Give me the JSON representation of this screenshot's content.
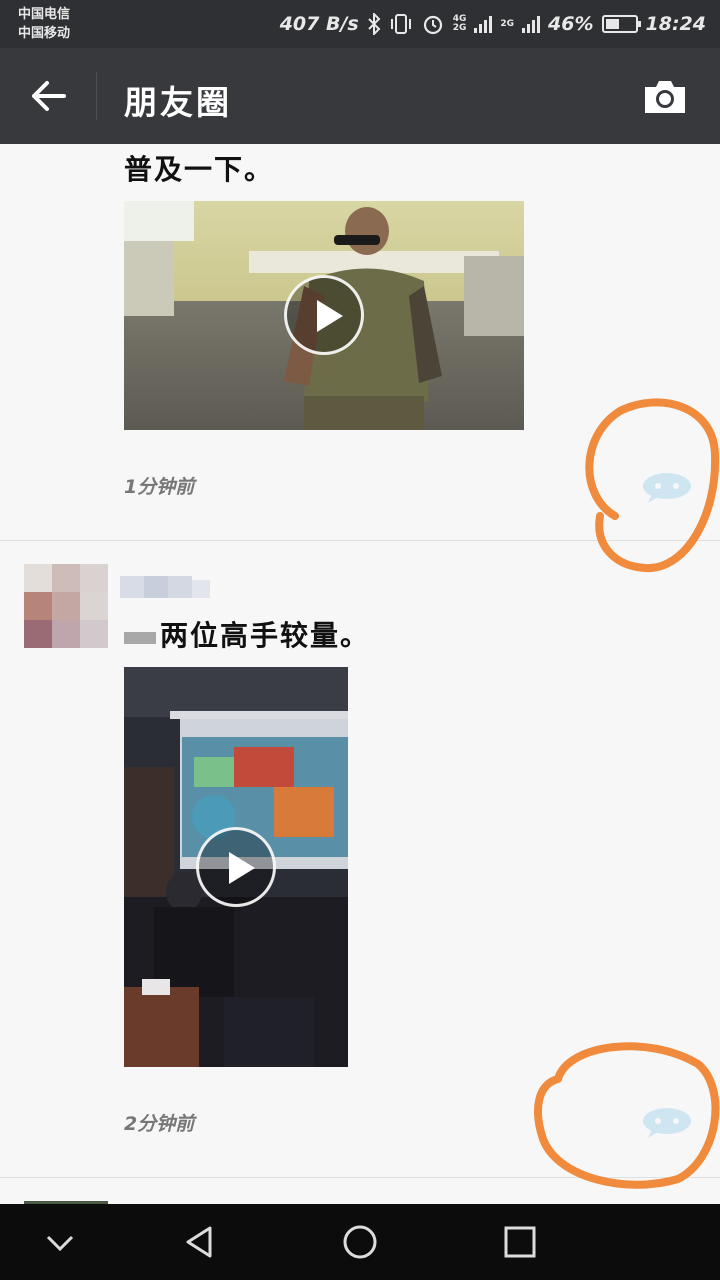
{
  "status_bar": {
    "carrier_1": "中国电信",
    "carrier_2": "中国移动",
    "net_speed": "407 B/s",
    "network_4g": "4G",
    "network_2g": "2G",
    "network_2g_b": "2G",
    "battery_percent": "46%",
    "time": "18:24",
    "battery_level": 0.46
  },
  "header": {
    "title": "朋友圈"
  },
  "posts": [
    {
      "text": "普及一下。",
      "timestamp": "1分钟前"
    },
    {
      "text": "两位高手较量。",
      "timestamp": "2分钟前"
    }
  ],
  "colors": {
    "annotation_circle": "#f08a3c",
    "comment_icon": "#cfe6f2",
    "header_bg": "#38393d"
  },
  "icons": {
    "back": "arrow-left-icon",
    "camera": "camera-icon",
    "play": "play-icon",
    "comment": "comment-icon",
    "nav_down": "chevron-down-icon",
    "nav_back": "triangle-back-icon",
    "nav_home": "circle-home-icon",
    "nav_recents": "square-recents-icon"
  }
}
